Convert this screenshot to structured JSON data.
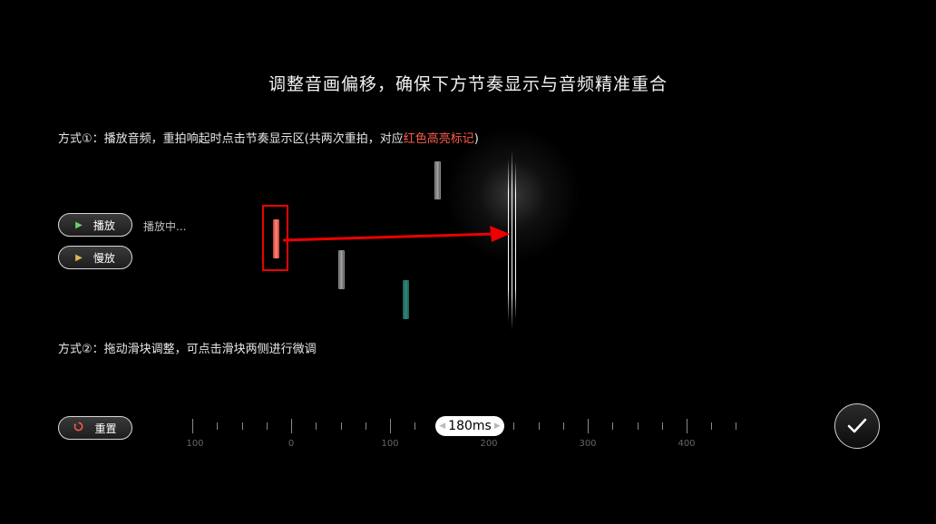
{
  "title": "调整音画偏移，确保下方节奏显示与音频精准重合",
  "method1": {
    "text": "方式①：播放音频，重拍响起时点击节奏显示区(共两次重拍，对应",
    "highlight": "红色高亮标记",
    "end": ")"
  },
  "method2": {
    "text": "方式②：拖动滑块调整，可点击滑块两侧进行微调"
  },
  "buttons": {
    "play": {
      "label": "播放",
      "icon": "play-icon"
    },
    "slow": {
      "label": "慢放",
      "icon": "play-icon"
    },
    "reset": {
      "label": "重置",
      "icon": "reset-icon"
    },
    "confirm": {
      "icon": "checkmark-icon"
    }
  },
  "status": "播放中...",
  "slider": {
    "value_label": "180ms",
    "value": 180,
    "tick_labels": [
      "100",
      "0",
      "100",
      "200",
      "300",
      "400"
    ]
  },
  "colors": {
    "highlight": "#ff5a4a",
    "marker": "#e00000",
    "teal": "#2e8c7d"
  }
}
